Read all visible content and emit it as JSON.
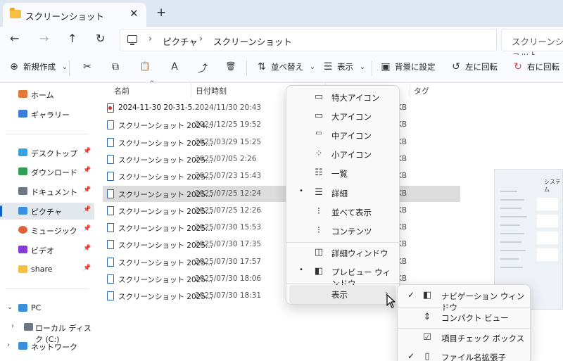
{
  "window": {
    "tab_title": "スクリーンショット",
    "tab_close": "✕",
    "tab_add": "+"
  },
  "nav": {
    "back": "←",
    "forward": "→",
    "up": "↑",
    "refresh": "↻",
    "breadcrumb": [
      "ピクチャ",
      "スクリーンショット"
    ],
    "chevron": "›",
    "search_placeholder": "スクリーンショット"
  },
  "toolbar": {
    "new_label": "新規作成",
    "new_icon": "⊕",
    "cut_icon": "✂",
    "copy_icon": "⧉",
    "paste_icon": "📋",
    "rename_icon": "A",
    "share_icon": "⤴",
    "delete_icon": "🗑",
    "sort_label": "並べ替え",
    "sort_icon": "⇅",
    "view_label": "表示",
    "view_icon": "☰",
    "dropdown": "⌄",
    "wallpaper_label": "背景に設定",
    "wallpaper_icon": "▣",
    "rotate_left_label": "左に回転",
    "rotate_left_icon": "↺",
    "rotate_right_label": "右に回転",
    "rotate_right_icon": "↻"
  },
  "sidebar": {
    "pin": "📌",
    "expand": "›",
    "collapse": "⌄",
    "items": [
      {
        "label": "ホーム",
        "color": "#e07a3a"
      },
      {
        "label": "ギャラリー",
        "color": "#3b7dd8"
      },
      {
        "label": "デスクトップ",
        "color": "#3aa0e0"
      },
      {
        "label": "ダウンロード",
        "color": "#2f9e59"
      },
      {
        "label": "ドキュメント",
        "color": "#6b7785"
      },
      {
        "label": "ピクチャ",
        "color": "#3b8fe0"
      },
      {
        "label": "ミュージック",
        "color": "#e0603a"
      },
      {
        "label": "ビデオ",
        "color": "#8a3ad8"
      },
      {
        "label": "share",
        "color": "#f5c043"
      },
      {
        "label": "PC",
        "color": "#3a8fd8"
      },
      {
        "label": "ローカル ディスク (C:)",
        "color": "#6b7785"
      },
      {
        "label": "ネットワーク",
        "color": "#3a8fd8"
      }
    ]
  },
  "columns": {
    "name": "名前",
    "date": "日付時刻",
    "tag": "タグ",
    "sort_arrow": "^"
  },
  "files": [
    {
      "name": "2024-11-30 20-31-5...",
      "date": "2024/11/30 20:43",
      "size": "KB"
    },
    {
      "name": "スクリーンショット 2024...",
      "date": "2024/12/25 19:52",
      "size": "KB"
    },
    {
      "name": "スクリーンショット 2025...",
      "date": "2025/03/29 15:25",
      "size": "KB"
    },
    {
      "name": "スクリーンショット 2025...",
      "date": "2025/07/05 2:26",
      "size": "KB"
    },
    {
      "name": "スクリーンショット 2025...",
      "date": "2025/07/23 15:43",
      "size": "KB"
    },
    {
      "name": "スクリーンショット 2025...",
      "date": "2025/07/25 12:24",
      "size": "KB"
    },
    {
      "name": "スクリーンショット 2025...",
      "date": "2025/07/25 12:26",
      "size": "KB"
    },
    {
      "name": "スクリーンショット 2025...",
      "date": "2025/07/30 15:53",
      "size": "KB"
    },
    {
      "name": "スクリーンショット 2025...",
      "date": "2025/07/30 17:35",
      "size": "KB"
    },
    {
      "name": "スクリーンショット 2025...",
      "date": "2025/07/30 17:57",
      "size": "KB"
    },
    {
      "name": "スクリーンショット 2025...",
      "date": "2025/07/30 18:06",
      "size": "KB"
    },
    {
      "name": "スクリーンショット 2025...",
      "date": "2025/07/30 18:31",
      "size": "KB"
    }
  ],
  "preview": {
    "title": "システム"
  },
  "view_menu": {
    "items": [
      {
        "label": "特大アイコン",
        "icon": "▭"
      },
      {
        "label": "大アイコン",
        "icon": "▭"
      },
      {
        "label": "中アイコン",
        "icon": "▭"
      },
      {
        "label": "小アイコン",
        "icon": "⁘"
      },
      {
        "label": "一覧",
        "icon": "☷"
      },
      {
        "label": "詳細",
        "icon": "☰"
      },
      {
        "label": "並べて表示",
        "icon": "⁝"
      },
      {
        "label": "コンテンツ",
        "icon": "⁝"
      },
      {
        "label": "詳細ウィンドウ",
        "icon": "◫"
      },
      {
        "label": "プレビュー ウィンドウ",
        "icon": "◧"
      },
      {
        "label": "表示",
        "icon": ""
      }
    ],
    "bullet": "•",
    "submenu_arrow": "›"
  },
  "show_menu": {
    "items": [
      {
        "label": "ナビゲーション ウィンドウ",
        "icon": "◧"
      },
      {
        "label": "コンパクト ビュー",
        "icon": "⇕"
      },
      {
        "label": "項目チェック ボックス",
        "icon": "☑"
      },
      {
        "label": "ファイル名拡張子",
        "icon": "▯"
      }
    ],
    "check": "✓"
  }
}
